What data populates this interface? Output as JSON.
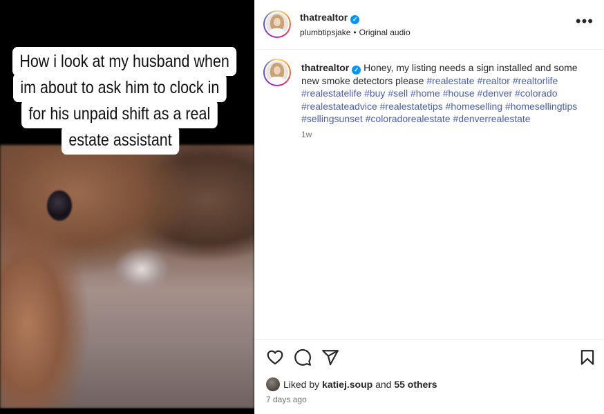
{
  "media": {
    "caption_lines": [
      "How i look at my husband when",
      "im about to ask him to clock in",
      "for his unpaid shift as a real",
      "estate assistant"
    ]
  },
  "header": {
    "username": "thatrealtor",
    "verified_icon": "verified-badge-icon",
    "audio_user": "plumbtipsjake",
    "audio_separator": "•",
    "audio_label": "Original audio",
    "more_icon": "more-options-icon",
    "more_glyph": "•••"
  },
  "post_caption": {
    "username": "thatrealtor",
    "text": "Honey, my listing needs a sign installed and some new smoke detectors please",
    "hashtags": [
      "#realestate",
      "#realtor",
      "#realtorlife",
      "#realestatelife",
      "#buy",
      "#sell",
      "#home",
      "#house",
      "#denver",
      "#colorado",
      "#realestateadvice",
      "#realestatetips",
      "#homeselling",
      "#homesellingtips",
      "#sellingsunset",
      "#coloradorealestate",
      "#denverrealestate"
    ],
    "time_ago": "1w"
  },
  "actions": {
    "like_icon": "heart-icon",
    "comment_icon": "comment-icon",
    "share_icon": "share-icon",
    "save_icon": "bookmark-icon"
  },
  "likes": {
    "prefix": "Liked by",
    "user": "katiej.soup",
    "and": "and",
    "others": "55 others"
  },
  "date": "7 days ago",
  "colors": {
    "hashtag": "#4a5eb5",
    "verified": "#0095f6",
    "muted": "#737373"
  }
}
